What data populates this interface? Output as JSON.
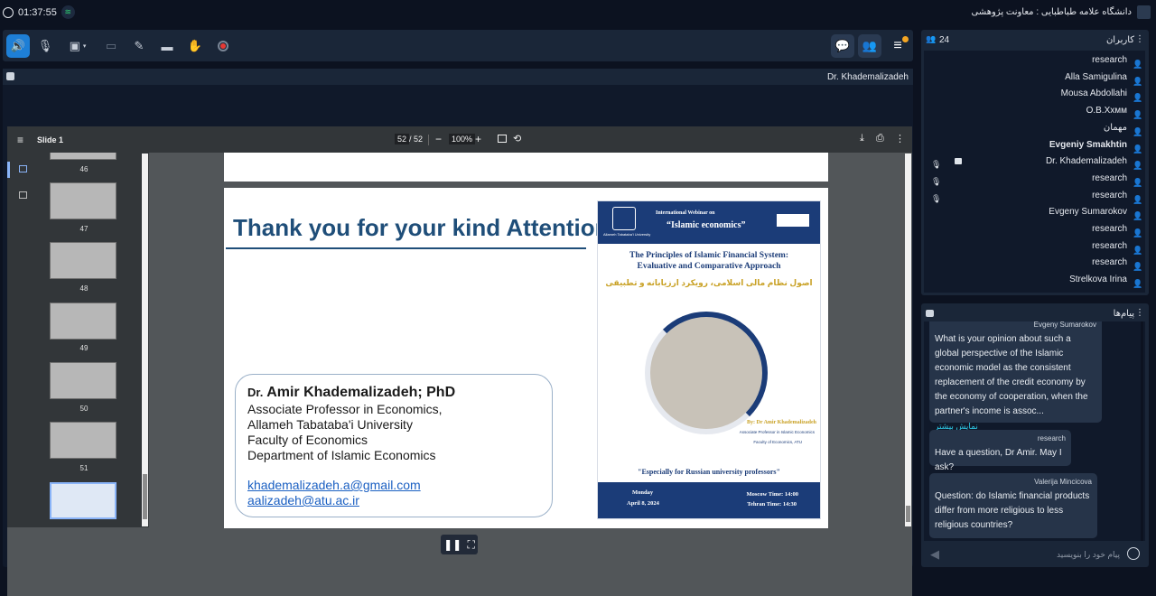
{
  "topbar": {
    "timer": "01:37:55",
    "org_title": "دانشگاه علامه طباطبایی : معاونت پژوهشی"
  },
  "stage": {
    "presenter": "Dr. Khademalizadeh"
  },
  "pdf": {
    "doc_title": "Slide 1",
    "page_current": "52",
    "page_sep": "/",
    "page_total": "52",
    "zoom": "100%",
    "thumbnails": [
      "46",
      "47",
      "48",
      "49",
      "50",
      "51"
    ]
  },
  "slide": {
    "title": "Thank you for your kind Attention",
    "name_prefix": "Dr.",
    "name": "Amir Khademalizadeh; PhD",
    "line1": "Associate Professor in Economics,",
    "line2": "Allameh Tabataba'i University",
    "line3": "Faculty of Economics",
    "line4": "Department of Islamic Economics",
    "email1": "khademalizadeh.a@gmail.com",
    "email2": "aalizadeh@atu.ac.ir"
  },
  "poster": {
    "webinar": "International Webinar on",
    "topic": "“Islamic economics”",
    "uni": "Allameh Tabataba'i University",
    "title1": "The Principles of Islamic Financial System:",
    "title2": "Evaluative and Comparative Approach",
    "farsi": "اصول نظام مالی اسلامی، رویکرد ارزیابانه و تطبیقی",
    "by": "By: Dr Amir Khademalizadeh",
    "role": "Associate Professor in Islamic Economics",
    "faculty": "Faculty of Economics, ATU",
    "special": "\"Especially for Russian university professors\"",
    "day": "Monday",
    "date": "April 8, 2024",
    "moscow": "Moscow Time: 14:00",
    "tehran": "Tehran Time: 14:30"
  },
  "users": {
    "title": "کاربران",
    "count": "24",
    "list": [
      {
        "name": "research",
        "mic": false,
        "cam": false,
        "bold": false
      },
      {
        "name": "Alla Samigulina",
        "mic": false,
        "cam": false,
        "bold": false
      },
      {
        "name": "Mousa Abdollahi",
        "mic": false,
        "cam": false,
        "bold": false
      },
      {
        "name": "O.B.Xхмм",
        "mic": false,
        "cam": false,
        "bold": false
      },
      {
        "name": "مهمان",
        "mic": false,
        "cam": false,
        "bold": false
      },
      {
        "name": "Evgeniy Smakhtin",
        "mic": false,
        "cam": false,
        "bold": true
      },
      {
        "name": "Dr. Khademalizadeh",
        "mic": true,
        "cam": true,
        "bold": false
      },
      {
        "name": "research",
        "mic": true,
        "cam": false,
        "bold": false
      },
      {
        "name": "research",
        "mic": true,
        "cam": false,
        "bold": false
      },
      {
        "name": "Evgeny Sumarokov",
        "mic": false,
        "cam": false,
        "bold": false
      },
      {
        "name": "research",
        "mic": false,
        "cam": false,
        "bold": false
      },
      {
        "name": "research",
        "mic": false,
        "cam": false,
        "bold": false
      },
      {
        "name": "research",
        "mic": false,
        "cam": false,
        "bold": false
      },
      {
        "name": "Strelkova Irina",
        "mic": false,
        "cam": false,
        "bold": false
      }
    ]
  },
  "chat": {
    "title": "پیام‌ها",
    "msg1_name": "Evgeny Sumarokov",
    "msg1_text": "What is your opinion about such a global perspective of the Islamic economic model as the consistent replacement of the credit economy by the economy of cooperation, when the partner's income is assoc...",
    "msg1_more": "نمایش بیشتر",
    "msg2_name": "research",
    "msg2_text": "Have a question, Dr Amir. May I ask?",
    "msg3_name": "Valerija Mincicova",
    "msg3_text": "Question: do Islamic financial products differ from more religious to less religious countries?",
    "placeholder": "پیام خود را بنویسید"
  },
  "colors": {
    "accent": "#1e7fd6",
    "panel": "#1a2638",
    "bg": "#0c1220",
    "user_icon": "#2ecbe8",
    "badge": "#f5a623"
  }
}
